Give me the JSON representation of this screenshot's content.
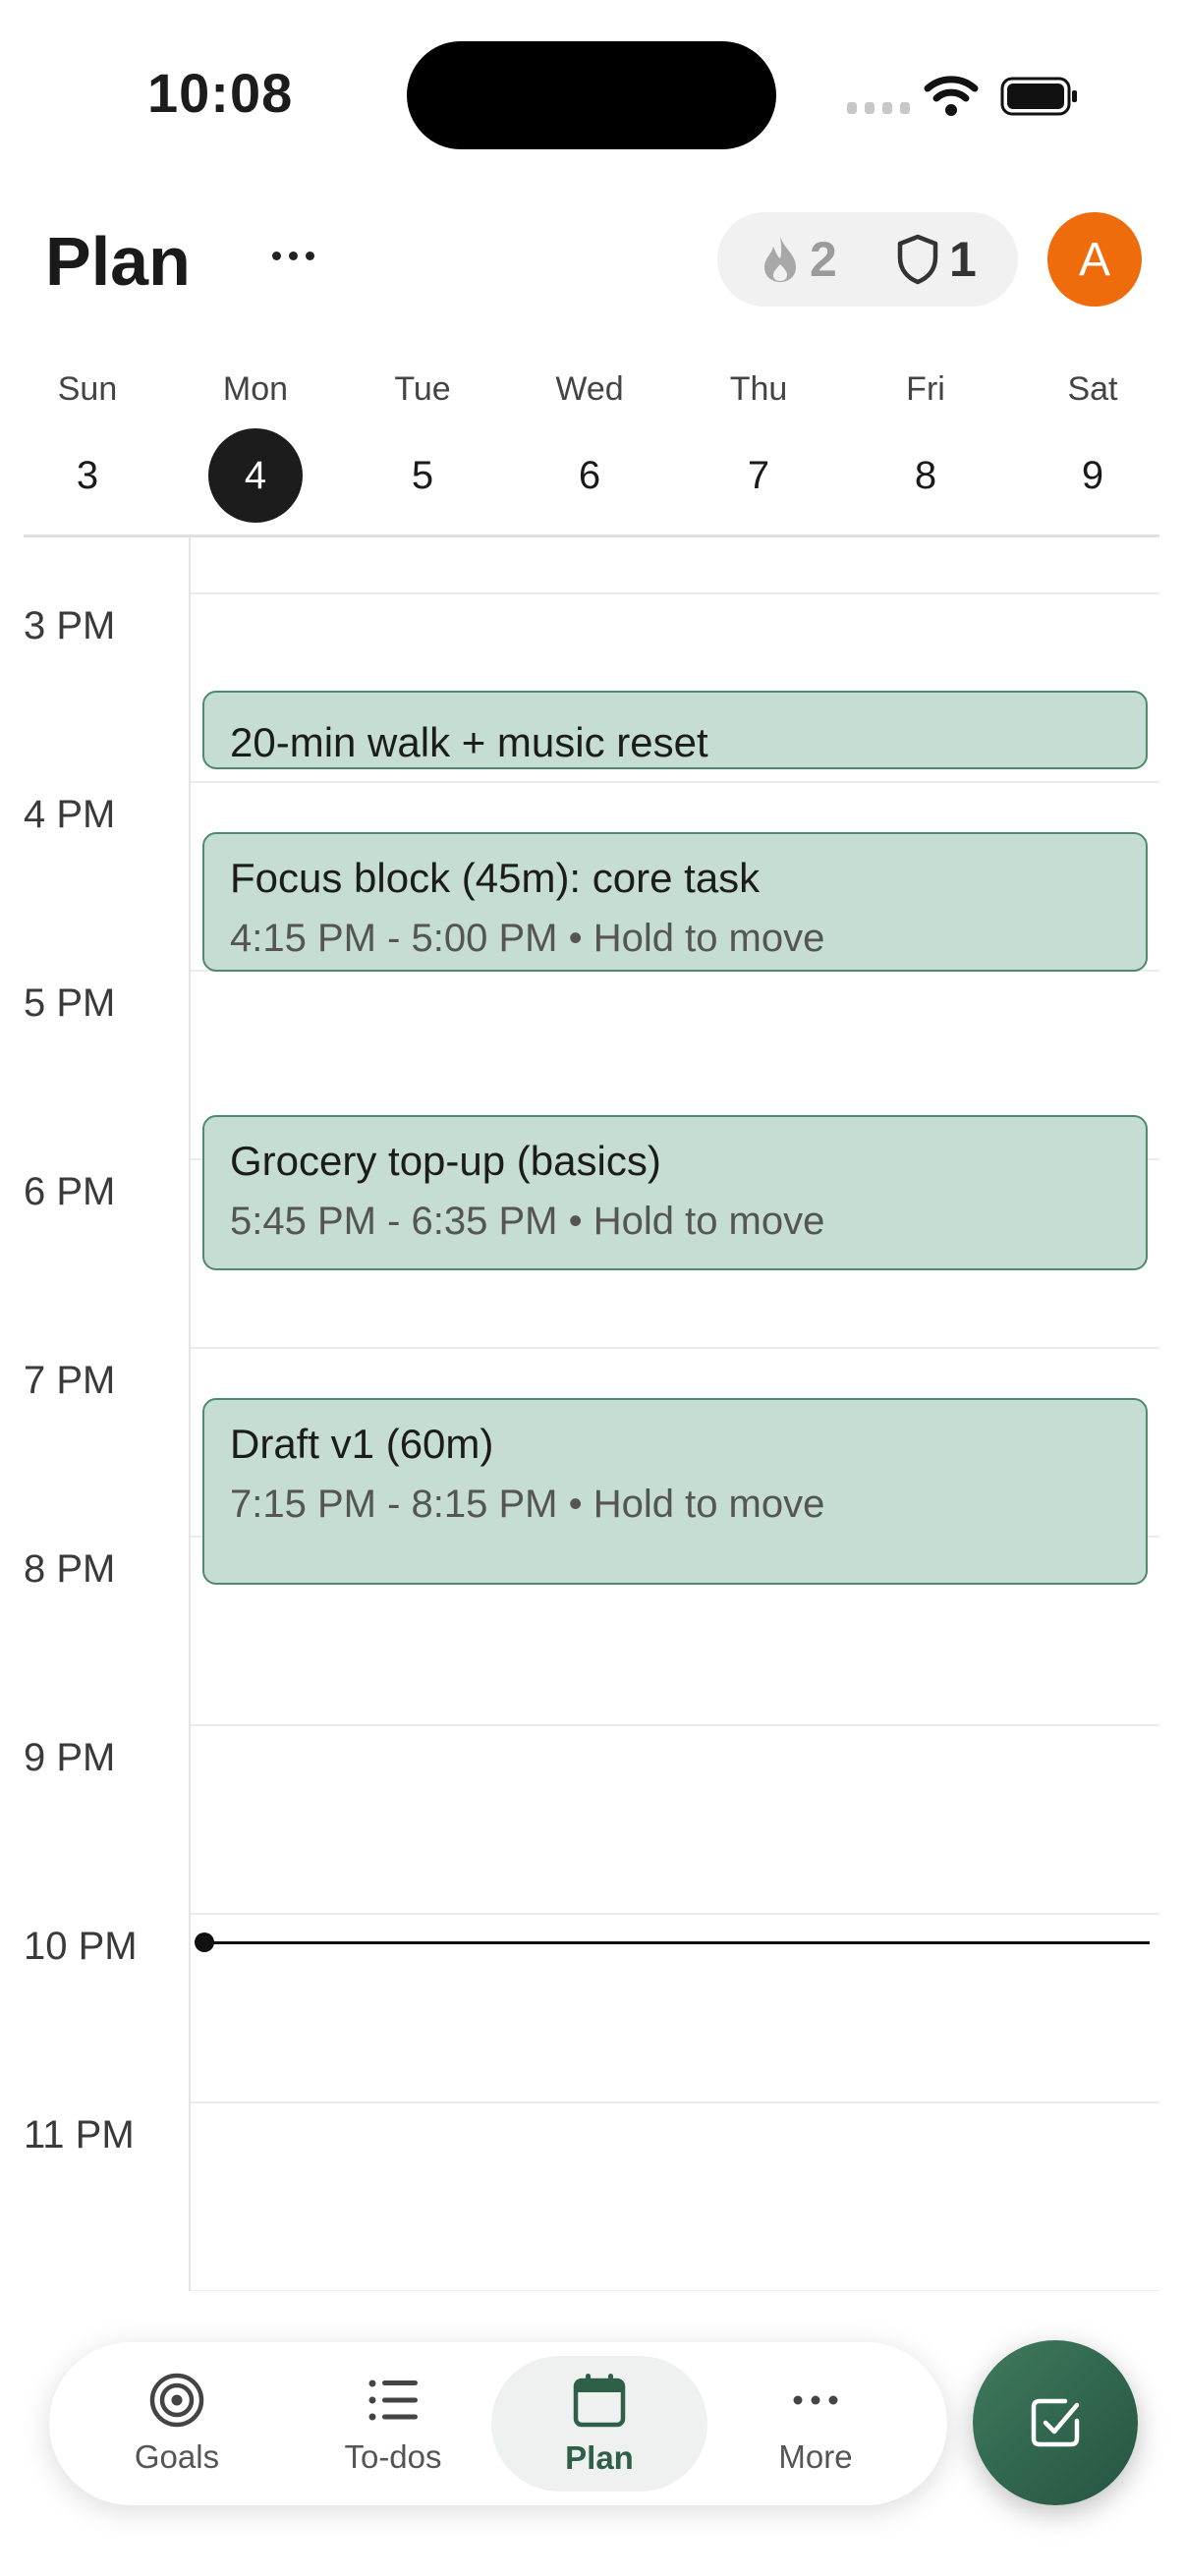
{
  "status_bar": {
    "time": "10:08"
  },
  "header": {
    "title": "Plan",
    "streak_count": "2",
    "shield_count": "1",
    "avatar_initial": "A",
    "avatar_color": "#ee6c0b"
  },
  "week": {
    "days": [
      {
        "name": "Sun",
        "num": "3"
      },
      {
        "name": "Mon",
        "num": "4",
        "selected": true
      },
      {
        "name": "Tue",
        "num": "5"
      },
      {
        "name": "Wed",
        "num": "6"
      },
      {
        "name": "Thu",
        "num": "7"
      },
      {
        "name": "Fri",
        "num": "8"
      },
      {
        "name": "Sat",
        "num": "9"
      }
    ]
  },
  "timeline": {
    "hours": [
      "3 PM",
      "4 PM",
      "5 PM",
      "6 PM",
      "7 PM",
      "8 PM",
      "9 PM",
      "10 PM",
      "11 PM"
    ],
    "events": [
      {
        "title": "20-min walk + music reset",
        "meta": ""
      },
      {
        "title": "Focus block (45m): core task",
        "meta": "4:15 PM - 5:00 PM • Hold to move"
      },
      {
        "title": "Grocery top-up (basics)",
        "meta": "5:45 PM - 6:35 PM • Hold to move"
      },
      {
        "title": "Draft v1 (60m)",
        "meta": "7:15 PM - 8:15 PM • Hold to move"
      }
    ],
    "event_color": "#c5ddd2",
    "event_border": "#4f8a6c"
  },
  "bottom_nav": {
    "items": [
      {
        "label": "Goals",
        "icon": "target-icon"
      },
      {
        "label": "To-dos",
        "icon": "list-icon"
      },
      {
        "label": "Plan",
        "icon": "calendar-icon",
        "active": true
      },
      {
        "label": "More",
        "icon": "more-dots-icon"
      }
    ],
    "fab_icon": "checkbox-icon",
    "accent": "#2f5f48"
  }
}
